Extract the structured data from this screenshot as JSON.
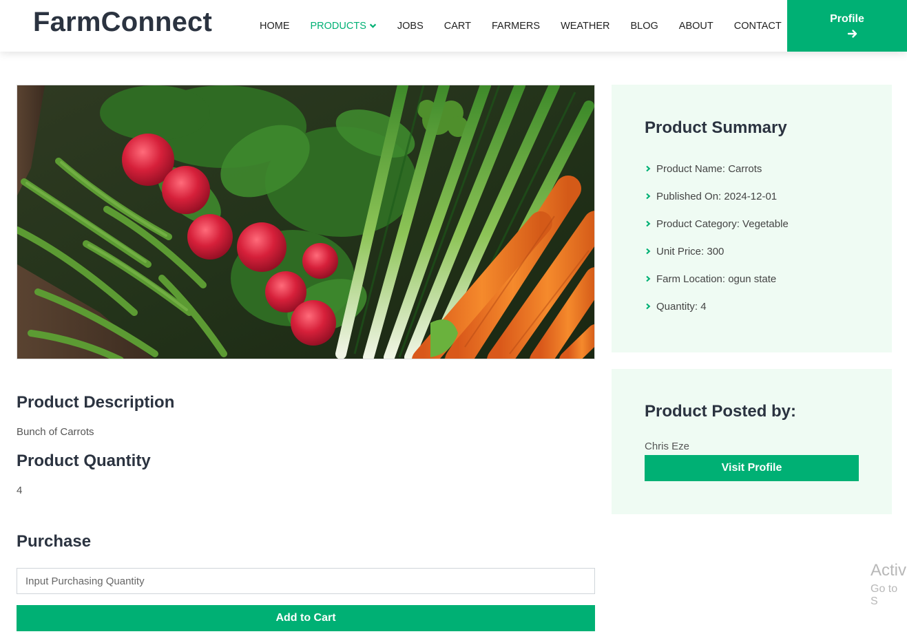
{
  "header": {
    "brand": "FarmConnect",
    "nav": [
      {
        "label": "HOME"
      },
      {
        "label": "PRODUCTS"
      },
      {
        "label": "JOBS"
      },
      {
        "label": "CART"
      },
      {
        "label": "FARMERS"
      },
      {
        "label": "WEATHER"
      },
      {
        "label": "BLOG"
      },
      {
        "label": "ABOUT"
      },
      {
        "label": "CONTACT"
      }
    ],
    "active_nav": "PRODUCTS",
    "profile_label": "Profile",
    "profile_icon": "arrow-right-icon"
  },
  "product": {
    "image_alt": "Fresh vegetables: radishes, green beans, spring onions and carrots",
    "description_title": "Product Description",
    "description": "Bunch of Carrots",
    "quantity_title": "Product Quantity",
    "quantity": "4",
    "purchase_title": "Purchase",
    "purchase_placeholder": "Input Purchasing Quantity",
    "add_to_cart": "Add to Cart"
  },
  "summary": {
    "title": "Product Summary",
    "items": [
      "Product Name: Carrots",
      "Published On: 2024-12-01",
      "Product Category: Vegetable",
      "Unit Price: 300",
      "Farm Location: ogun state",
      "Quantity: 4"
    ]
  },
  "poster": {
    "title": "Product Posted by:",
    "name": "Chris Eze",
    "visit_label": "Visit Profile"
  },
  "watermark": {
    "line1": "Activ",
    "line2": "Go to S"
  },
  "colors": {
    "accent": "#00b074",
    "card_bg": "#effbf3",
    "heading": "#2b3340"
  }
}
